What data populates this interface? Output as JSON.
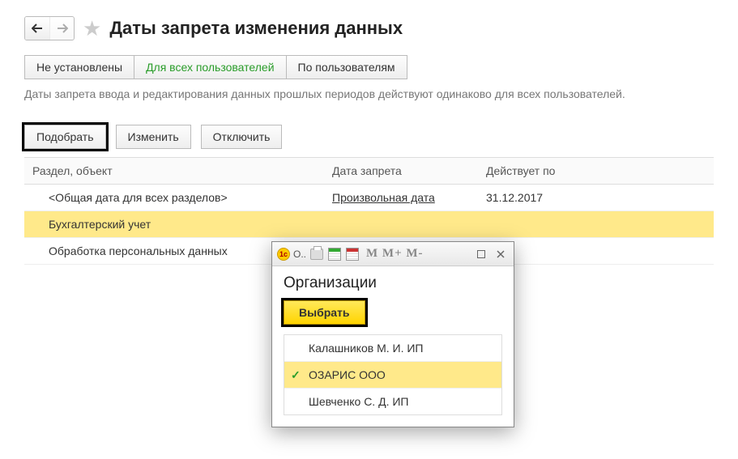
{
  "header": {
    "title": "Даты запрета изменения данных"
  },
  "tabs": {
    "t0": "Не установлены",
    "t1": "Для всех пользователей",
    "t2": "По пользователям"
  },
  "description": "Даты запрета ввода и редактирования данных прошлых периодов действуют одинаково для всех пользователей.",
  "toolbar": {
    "pick": "Подобрать",
    "edit": "Изменить",
    "disable": "Отключить"
  },
  "columns": {
    "c1": "Раздел, объект",
    "c2": "Дата запрета",
    "c3": "Действует по"
  },
  "rows": [
    {
      "name": "<Общая дата для всех разделов>",
      "kind": "Произвольная дата",
      "until": "31.12.2017"
    },
    {
      "name": "Бухгалтерский учет",
      "kind": "",
      "until": ""
    },
    {
      "name": "Обработка персональных данных",
      "kind": "",
      "until": ""
    }
  ],
  "popup": {
    "winlabel": "О..",
    "mgroup": "M M+ M-",
    "title": "Организации",
    "select": "Выбрать",
    "orgs": [
      {
        "name": "Калашников М. И. ИП",
        "selected": false
      },
      {
        "name": "ОЗАРИС ООО",
        "selected": true
      },
      {
        "name": "Шевченко С. Д. ИП",
        "selected": false
      }
    ]
  }
}
